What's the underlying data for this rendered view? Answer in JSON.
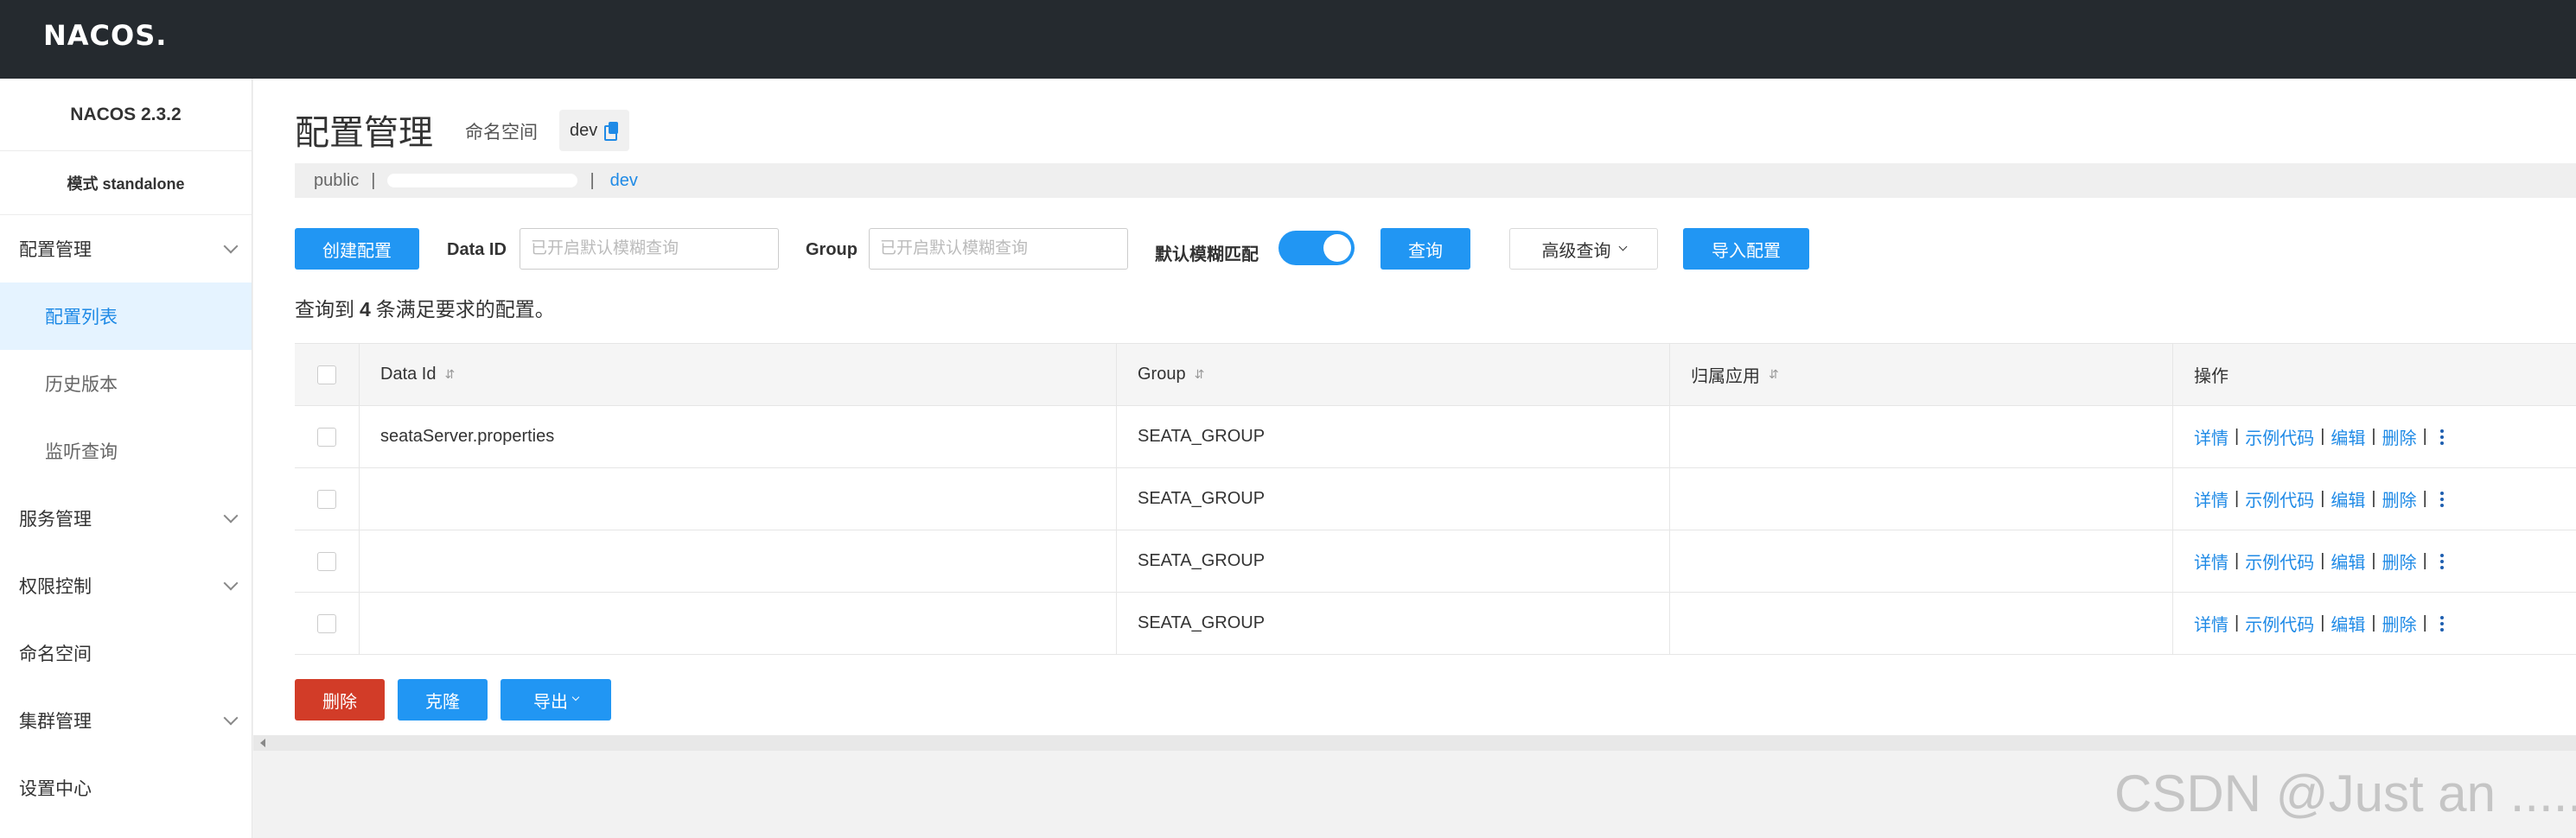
{
  "header": {
    "logo": "NACOS."
  },
  "sidebar": {
    "version": "NACOS 2.3.2",
    "mode": "模式 standalone",
    "items": [
      {
        "label": "配置管理"
      },
      {
        "label": "配置列表"
      },
      {
        "label": "历史版本"
      },
      {
        "label": "监听查询"
      },
      {
        "label": "服务管理"
      },
      {
        "label": "权限控制"
      },
      {
        "label": "命名空间"
      },
      {
        "label": "集群管理"
      },
      {
        "label": "设置中心"
      }
    ]
  },
  "main": {
    "title": "配置管理",
    "namespace_label": "命名空间",
    "namespace_value": "dev",
    "ns_bar": {
      "public": "public",
      "sep": "|",
      "sep2": "|",
      "dev": "dev"
    },
    "toolbar": {
      "create": "创建配置",
      "dataid_label": "Data ID",
      "dataid_placeholder": "已开启默认模糊查询",
      "group_label": "Group",
      "group_placeholder": "已开启默认模糊查询",
      "fuzzy_label": "默认模糊匹配",
      "query": "查询",
      "advanced": "高级查询",
      "import": "导入配置"
    },
    "result": {
      "prefix": "查询到",
      "count": "4",
      "suffix": "条满足要求的配置。"
    },
    "table": {
      "headers": {
        "data_id": "Data Id",
        "group": "Group",
        "app": "归属应用",
        "ops": "操作",
        "sort": "⇵"
      },
      "rows": [
        {
          "data_id": "seataServer.properties",
          "group": "SEATA_GROUP",
          "app": ""
        },
        {
          "data_id": "",
          "group": "SEATA_GROUP",
          "app": ""
        },
        {
          "data_id": "",
          "group": "SEATA_GROUP",
          "app": ""
        },
        {
          "data_id": "",
          "group": "SEATA_GROUP",
          "app": ""
        }
      ],
      "ops": {
        "detail": "详情",
        "sample": "示例代码",
        "edit": "编辑",
        "delete": "删除",
        "sep": "|"
      }
    },
    "bottom": {
      "delete": "删除",
      "clone": "克隆",
      "export": "导出"
    }
  },
  "watermark": "CSDN @Just an ......"
}
